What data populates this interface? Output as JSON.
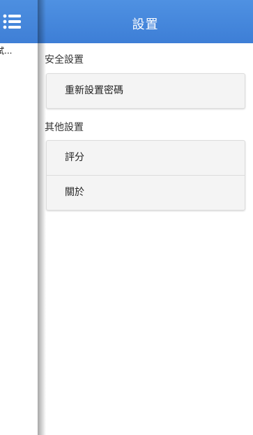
{
  "drawer": {
    "menu_icon": "list-icon",
    "item_label": "試..."
  },
  "header": {
    "title": "設置"
  },
  "sections": [
    {
      "title": "安全設置",
      "items": [
        {
          "label": "重新設置密碼"
        }
      ]
    },
    {
      "title": "其他設置",
      "items": [
        {
          "label": "評分"
        },
        {
          "label": "關於"
        }
      ]
    }
  ],
  "colors": {
    "header_blue": "#4388dc",
    "row_bg": "#f4f4f4"
  }
}
